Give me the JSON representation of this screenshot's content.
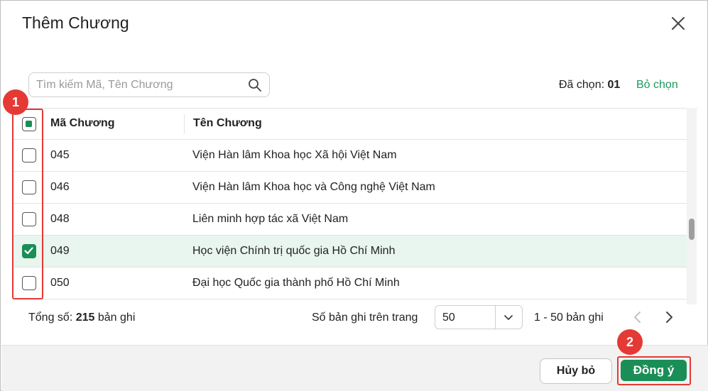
{
  "dialog": {
    "title": "Thêm Chương"
  },
  "search": {
    "placeholder": "Tìm kiếm Mã, Tên Chương"
  },
  "selection": {
    "label": "Đã chọn:",
    "count": "01",
    "clear_label": "Bỏ chọn"
  },
  "table": {
    "columns": [
      "Mã Chương",
      "Tên Chương"
    ],
    "rows": [
      {
        "code": "045",
        "name": "Viện Hàn lâm Khoa học Xã hội Việt Nam",
        "checked": false
      },
      {
        "code": "046",
        "name": "Viện Hàn lâm Khoa học và Công nghệ Việt Nam",
        "checked": false
      },
      {
        "code": "048",
        "name": "Liên minh hợp tác xã Việt Nam",
        "checked": false
      },
      {
        "code": "049",
        "name": "Học viện Chính trị quốc gia Hồ Chí Minh",
        "checked": true
      },
      {
        "code": "050",
        "name": "Đại học Quốc gia thành phố Hồ Chí Minh",
        "checked": false
      }
    ]
  },
  "pagination": {
    "total_prefix": "Tổng số:",
    "total_count": "215",
    "total_suffix": "bản ghi",
    "per_page_label": "Số bản ghi trên trang",
    "per_page_value": "50",
    "range": "1 - 50 bản ghi"
  },
  "annotations": {
    "badge_1": "1",
    "badge_2": "2"
  },
  "buttons": {
    "cancel": "Hủy bỏ",
    "ok": "Đồng ý"
  },
  "colors": {
    "accent": "#1a8e56",
    "highlight": "#e53935",
    "selected_row": "#e9f5ef"
  },
  "icons": {
    "close": "close-icon",
    "search": "search-icon",
    "dropdown": "chevron-down-icon",
    "prev": "chevron-left-icon",
    "next": "chevron-right-icon"
  }
}
